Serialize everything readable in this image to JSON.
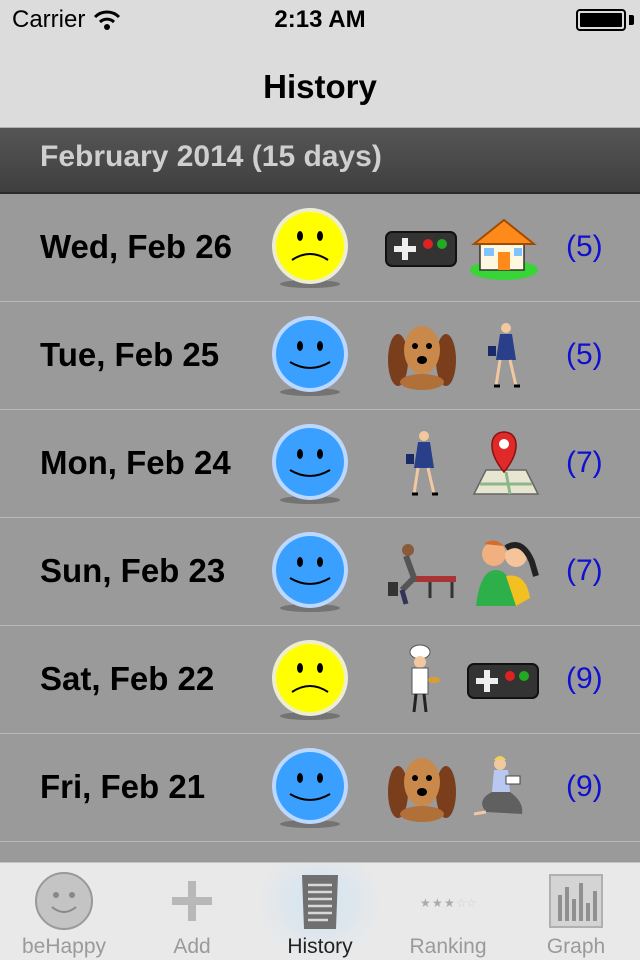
{
  "status_bar": {
    "carrier": "Carrier",
    "time": "2:13 AM"
  },
  "nav": {
    "title": "History"
  },
  "section": {
    "title": "February 2014 (15 days)"
  },
  "rows": [
    {
      "date": "Wed, Feb 26",
      "mood": "neutral-yellow-face-icon",
      "activities": [
        "gamepad-icon",
        "house-icon"
      ],
      "count": "(5)"
    },
    {
      "date": "Tue, Feb 25",
      "mood": "happy-blue-face-icon",
      "activities": [
        "dog-icon",
        "businesswoman-icon"
      ],
      "count": "(5)"
    },
    {
      "date": "Mon, Feb 24",
      "mood": "happy-blue-face-icon",
      "activities": [
        "businesswoman-icon",
        "map-pin-icon"
      ],
      "count": "(7)"
    },
    {
      "date": "Sun, Feb 23",
      "mood": "happy-blue-face-icon",
      "activities": [
        "weightlifting-icon",
        "hugging-couple-icon"
      ],
      "count": "(7)"
    },
    {
      "date": "Sat, Feb 22",
      "mood": "neutral-yellow-face-icon",
      "activities": [
        "chef-icon",
        "gamepad-icon"
      ],
      "count": "(9)"
    },
    {
      "date": "Fri, Feb 21",
      "mood": "happy-blue-face-icon",
      "activities": [
        "dog-icon",
        "reading-woman-icon"
      ],
      "count": "(9)"
    }
  ],
  "tabs": [
    {
      "label": "beHappy",
      "icon": "smiley-icon",
      "active": false
    },
    {
      "label": "Add",
      "icon": "plus-icon",
      "active": false
    },
    {
      "label": "History",
      "icon": "document-icon",
      "active": true
    },
    {
      "label": "Ranking",
      "icon": "stars-icon",
      "active": false
    },
    {
      "label": "Graph",
      "icon": "bar-chart-icon",
      "active": false
    }
  ],
  "colors": {
    "count_text": "#1010d0",
    "section_bg": "#4a4a4a",
    "list_bg": "#9a9a9a",
    "happy_face": "#3aa0ff",
    "neutral_face": "#ffff00"
  }
}
